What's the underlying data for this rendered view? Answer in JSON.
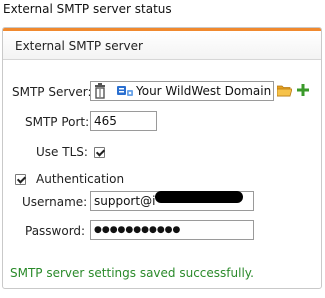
{
  "page": {
    "title": "External SMTP server status"
  },
  "panel": {
    "title": "External SMTP server"
  },
  "form": {
    "smtp_server": {
      "label": "SMTP Server:",
      "value": "Your WildWest Domain"
    },
    "smtp_port": {
      "label": "SMTP Port:",
      "value": "465"
    },
    "use_tls": {
      "label": "Use TLS:",
      "checked": true
    },
    "authentication": {
      "label": "Authentication",
      "checked": true
    },
    "username": {
      "label": "Username:",
      "value": "support@i"
    },
    "password": {
      "label": "Password:",
      "value": "●●●●●●●●●●●"
    }
  },
  "status_message": "SMTP server settings saved successfully.",
  "colors": {
    "accent": "#f0892e",
    "status_text": "#2a8a2a",
    "add_icon": "#3a9a2a",
    "folder_icon": "#e6a020",
    "server_icon": "#2a6fd0"
  },
  "icons": [
    "trash-icon",
    "server-icon",
    "folder-icon",
    "add-icon"
  ]
}
